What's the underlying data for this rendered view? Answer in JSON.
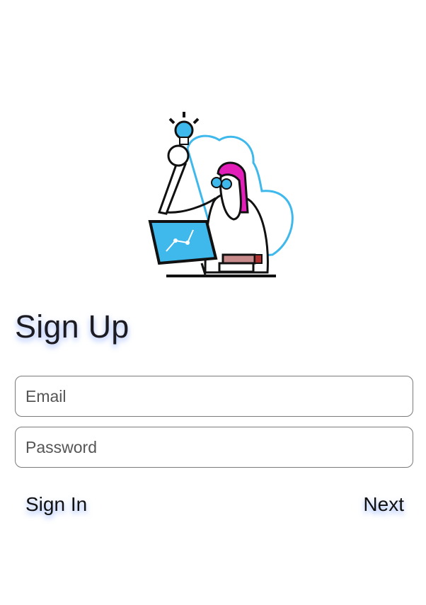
{
  "header": {
    "title": "Sign Up"
  },
  "form": {
    "email": {
      "placeholder": "Email",
      "value": ""
    },
    "password": {
      "placeholder": "Password",
      "value": ""
    }
  },
  "actions": {
    "sign_in_label": "Sign In",
    "next_label": "Next"
  },
  "illustration": {
    "icon": "person-with-lightbulb-illustration"
  },
  "colors": {
    "accent": "#3fb8ec",
    "hair": "#e21fb8",
    "books": "#c88a8a",
    "text": "#1c1b22"
  }
}
